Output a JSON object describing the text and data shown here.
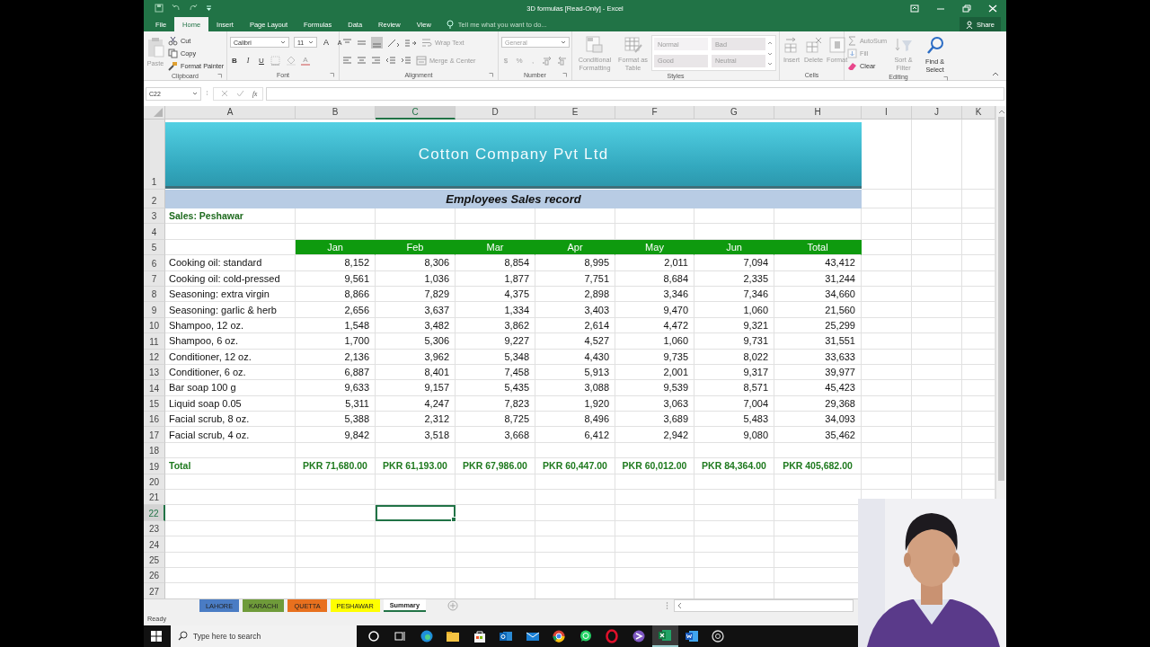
{
  "window": {
    "title": "3D formulas  [Read-Only] - Excel"
  },
  "ribbon_tabs": [
    {
      "label": "File",
      "selected": false
    },
    {
      "label": "Home",
      "selected": true
    },
    {
      "label": "Insert",
      "selected": false
    },
    {
      "label": "Page Layout",
      "selected": false
    },
    {
      "label": "Formulas",
      "selected": false
    },
    {
      "label": "Data",
      "selected": false
    },
    {
      "label": "Review",
      "selected": false
    },
    {
      "label": "View",
      "selected": false
    }
  ],
  "tell_me": {
    "placeholder": "Tell me what you want to do..."
  },
  "share": "Share",
  "ribbon": {
    "groups": [
      {
        "label": "Clipboard",
        "blocks": [
          {
            "kind": "large",
            "control": {
              "kind": "paste",
              "label": "Paste",
              "disabled": true
            }
          },
          {
            "kind": "stack",
            "lines": [
              [
                {
                  "kind": "cut",
                  "label": "Cut",
                  "disabled": false
                }
              ],
              [
                {
                  "kind": "copy",
                  "label": "Copy",
                  "disabled": false
                }
              ],
              [
                {
                  "kind": "brush",
                  "label": "Format Painter",
                  "disabled": false
                }
              ]
            ]
          }
        ]
      },
      {
        "label": "Font",
        "blocks": [
          {
            "kind": "stack",
            "lines": [
              [
                {
                  "kind": "fontfield",
                  "value": "Calibri",
                  "disabled": false
                },
                {
                  "kind": "sizefield",
                  "value": "11",
                  "disabled": false
                },
                {
                  "kind": "grow",
                  "label": "A",
                  "disabled": false
                },
                {
                  "kind": "shrink",
                  "label": "A",
                  "disabled": false
                }
              ],
              [
                {
                  "kind": "bold",
                  "label": "B",
                  "disabled": false
                },
                {
                  "kind": "italic",
                  "label": "I",
                  "disabled": false
                },
                {
                  "kind": "underline",
                  "label": "U",
                  "disabled": false
                },
                {
                  "kind": "border",
                  "disabled": true
                },
                {
                  "kind": "fill",
                  "disabled": true
                },
                {
                  "kind": "fontcolor",
                  "label": "A",
                  "disabled": true
                }
              ]
            ]
          }
        ]
      },
      {
        "label": "Alignment",
        "blocks": [
          {
            "kind": "stack",
            "lines": [
              [
                {
                  "kind": "aligntop",
                  "disabled": false
                },
                {
                  "kind": "alignmid",
                  "disabled": false
                },
                {
                  "kind": "alignbottom",
                  "disabled": false
                },
                {
                  "kind": "orient",
                  "disabled": false
                },
                {
                  "kind": "rtl",
                  "disabled": false
                },
                {
                  "kind": "wrap",
                  "label": "Wrap Text",
                  "disabled": true
                }
              ],
              [
                {
                  "kind": "left",
                  "disabled": false
                },
                {
                  "kind": "center",
                  "disabled": false
                },
                {
                  "kind": "right",
                  "disabled": false
                },
                {
                  "kind": "outdent",
                  "disabled": false
                },
                {
                  "kind": "indent",
                  "disabled": false
                },
                {
                  "kind": "merge",
                  "label": "Merge & Center",
                  "disabled": true
                }
              ]
            ]
          }
        ]
      },
      {
        "label": "Number",
        "blocks": [
          {
            "kind": "stack",
            "lines": [
              [
                {
                  "kind": "formatfield",
                  "value": "General",
                  "disabled": true
                }
              ],
              [
                {
                  "kind": "currency",
                  "label": "$",
                  "disabled": true
                },
                {
                  "kind": "percent",
                  "label": "%",
                  "disabled": true
                },
                {
                  "kind": "comma",
                  "label": ",",
                  "disabled": true
                },
                {
                  "kind": "incdec",
                  "disabled": true
                },
                {
                  "kind": "decdec",
                  "disabled": true
                }
              ]
            ]
          }
        ]
      },
      {
        "label": "Styles",
        "blocks": [
          {
            "kind": "large",
            "control": {
              "kind": "condfmt",
              "label": "Conditional Formatting",
              "disabled": true
            }
          },
          {
            "kind": "large",
            "control": {
              "kind": "table",
              "label": "Format as Table",
              "disabled": true
            }
          },
          {
            "kind": "gallery",
            "styles": [
              {
                "label": "Normal",
                "disabled": true
              },
              {
                "label": "Bad",
                "disabled": true
              },
              {
                "label": "Good",
                "disabled": true
              },
              {
                "label": "Neutral",
                "disabled": true
              }
            ]
          }
        ]
      },
      {
        "label": "Cells",
        "blocks": [
          {
            "kind": "large",
            "control": {
              "kind": "insert",
              "label": "Insert",
              "disabled": true
            }
          },
          {
            "kind": "large",
            "control": {
              "kind": "delete",
              "label": "Delete",
              "disabled": true
            }
          },
          {
            "kind": "large",
            "control": {
              "kind": "format",
              "label": "Format",
              "disabled": true
            }
          }
        ]
      },
      {
        "label": "Editing",
        "blocks": [
          {
            "kind": "stack",
            "lines": [
              [
                {
                  "kind": "sum",
                  "label": "AutoSum",
                  "disabled": true
                }
              ],
              [
                {
                  "kind": "filldown",
                  "label": "Fill",
                  "disabled": true
                }
              ],
              [
                {
                  "kind": "clear",
                  "label": "Clear",
                  "disabled": false
                }
              ]
            ]
          },
          {
            "kind": "large",
            "control": {
              "kind": "sort",
              "label": "Sort & Filter",
              "disabled": true
            }
          },
          {
            "kind": "large",
            "control": {
              "kind": "find",
              "label": "Find & Select",
              "disabled": false
            }
          }
        ]
      }
    ]
  },
  "formula_bar": {
    "name_box": "C22",
    "function_button": "fx"
  },
  "sheet": {
    "columns": [
      {
        "label": "A",
        "selected": false
      },
      {
        "label": "B",
        "selected": false
      },
      {
        "label": "C",
        "selected": true
      },
      {
        "label": "D",
        "selected": false
      },
      {
        "label": "E",
        "selected": false
      },
      {
        "label": "F",
        "selected": false
      },
      {
        "label": "G",
        "selected": false
      },
      {
        "label": "H",
        "selected": false
      },
      {
        "label": "I",
        "selected": false
      },
      {
        "label": "J",
        "selected": false
      },
      {
        "label": "K",
        "selected": false
      }
    ],
    "rows": [
      {
        "number": "1",
        "selected": false,
        "kind": "banner",
        "text": "Cotton Company Pvt Ltd"
      },
      {
        "number": "2",
        "selected": false,
        "kind": "subtitle",
        "text": "Employees Sales record"
      },
      {
        "number": "3",
        "selected": false,
        "kind": "label",
        "cells": [
          "Sales: Peshawar"
        ]
      },
      {
        "number": "4",
        "selected": false,
        "kind": "blank"
      },
      {
        "number": "5",
        "selected": false,
        "kind": "header",
        "cells": [
          "Jan",
          "Feb",
          "Mar",
          "Apr",
          "May",
          "Jun",
          "Total"
        ]
      },
      {
        "number": "6",
        "selected": false,
        "kind": "data",
        "cells": [
          "Cooking oil: standard",
          "8,152",
          "8,306",
          "8,854",
          "8,995",
          "2,011",
          "7,094",
          "43,412"
        ]
      },
      {
        "number": "7",
        "selected": false,
        "kind": "data",
        "cells": [
          "Cooking oil: cold-pressed",
          "9,561",
          "1,036",
          "1,877",
          "7,751",
          "8,684",
          "2,335",
          "31,244"
        ]
      },
      {
        "number": "8",
        "selected": false,
        "kind": "data",
        "cells": [
          "Seasoning: extra virgin",
          "8,866",
          "7,829",
          "4,375",
          "2,898",
          "3,346",
          "7,346",
          "34,660"
        ]
      },
      {
        "number": "9",
        "selected": false,
        "kind": "data",
        "cells": [
          "Seasoning: garlic & herb",
          "2,656",
          "3,637",
          "1,334",
          "3,403",
          "9,470",
          "1,060",
          "21,560"
        ]
      },
      {
        "number": "10",
        "selected": false,
        "kind": "data",
        "cells": [
          "Shampoo, 12 oz.",
          "1,548",
          "3,482",
          "3,862",
          "2,614",
          "4,472",
          "9,321",
          "25,299"
        ]
      },
      {
        "number": "11",
        "selected": false,
        "kind": "data",
        "cells": [
          "Shampoo, 6 oz.",
          "1,700",
          "5,306",
          "9,227",
          "4,527",
          "1,060",
          "9,731",
          "31,551"
        ]
      },
      {
        "number": "12",
        "selected": false,
        "kind": "data",
        "cells": [
          "Conditioner, 12 oz.",
          "2,136",
          "3,962",
          "5,348",
          "4,430",
          "9,735",
          "8,022",
          "33,633"
        ]
      },
      {
        "number": "13",
        "selected": false,
        "kind": "data",
        "cells": [
          "Conditioner, 6 oz.",
          "6,887",
          "8,401",
          "7,458",
          "5,913",
          "2,001",
          "9,317",
          "39,977"
        ]
      },
      {
        "number": "14",
        "selected": false,
        "kind": "data",
        "cells": [
          "Bar soap 100 g",
          "9,633",
          "9,157",
          "5,435",
          "3,088",
          "9,539",
          "8,571",
          "45,423"
        ]
      },
      {
        "number": "15",
        "selected": false,
        "kind": "data",
        "cells": [
          "Liquid soap 0.05",
          "5,311",
          "4,247",
          "7,823",
          "1,920",
          "3,063",
          "7,004",
          "29,368"
        ]
      },
      {
        "number": "16",
        "selected": false,
        "kind": "data",
        "cells": [
          "Facial scrub, 8 oz.",
          "5,388",
          "2,312",
          "8,725",
          "8,496",
          "3,689",
          "5,483",
          "34,093"
        ]
      },
      {
        "number": "17",
        "selected": false,
        "kind": "data",
        "cells": [
          "Facial scrub, 4 oz.",
          "9,842",
          "3,518",
          "3,668",
          "6,412",
          "2,942",
          "9,080",
          "35,462"
        ]
      },
      {
        "number": "18",
        "selected": false,
        "kind": "blank"
      },
      {
        "number": "19",
        "selected": false,
        "kind": "total",
        "cells": [
          "Total",
          "PKR 71,680.00",
          "PKR 61,193.00",
          "PKR 67,986.00",
          "PKR 60,447.00",
          "PKR 60,012.00",
          "PKR 84,364.00",
          "PKR 405,682.00"
        ]
      },
      {
        "number": "20",
        "selected": false,
        "kind": "blank"
      },
      {
        "number": "21",
        "selected": false,
        "kind": "blank"
      },
      {
        "number": "22",
        "selected": true,
        "kind": "blank"
      },
      {
        "number": "23",
        "selected": false,
        "kind": "blank"
      },
      {
        "number": "24",
        "selected": false,
        "kind": "blank"
      },
      {
        "number": "25",
        "selected": false,
        "kind": "blank"
      },
      {
        "number": "26",
        "selected": false,
        "kind": "blank"
      },
      {
        "number": "27",
        "selected": false,
        "kind": "blank"
      }
    ]
  },
  "sheet_tabs": [
    {
      "label": "LAHORE",
      "color": "#4a7cc4",
      "selected": false
    },
    {
      "label": "KARACHI",
      "color": "#6f9b3a",
      "selected": false
    },
    {
      "label": "QUETTA",
      "color": "#e8701e",
      "selected": false
    },
    {
      "label": "PESHAWAR",
      "color": "#ffff00",
      "selected": false
    },
    {
      "label": "Summary",
      "selected": true
    }
  ],
  "status_bar": {
    "text": "Ready"
  },
  "taskbar": {
    "search": {
      "placeholder": "Type here to search"
    },
    "apps": [
      {
        "kind": "circle",
        "active": false
      },
      {
        "kind": "taskview",
        "active": false
      },
      {
        "kind": "browser",
        "active": false
      },
      {
        "kind": "folder",
        "active": false
      },
      {
        "kind": "store",
        "active": false
      },
      {
        "kind": "mailapp",
        "active": false
      },
      {
        "kind": "envelope",
        "active": false
      },
      {
        "kind": "chrome",
        "active": false
      },
      {
        "kind": "chat",
        "active": false
      },
      {
        "kind": "ring",
        "active": false
      },
      {
        "kind": "orb",
        "active": false
      },
      {
        "kind": "sheet",
        "active": true
      },
      {
        "kind": "doc",
        "active": false
      },
      {
        "kind": "aperture",
        "active": false
      }
    ]
  }
}
